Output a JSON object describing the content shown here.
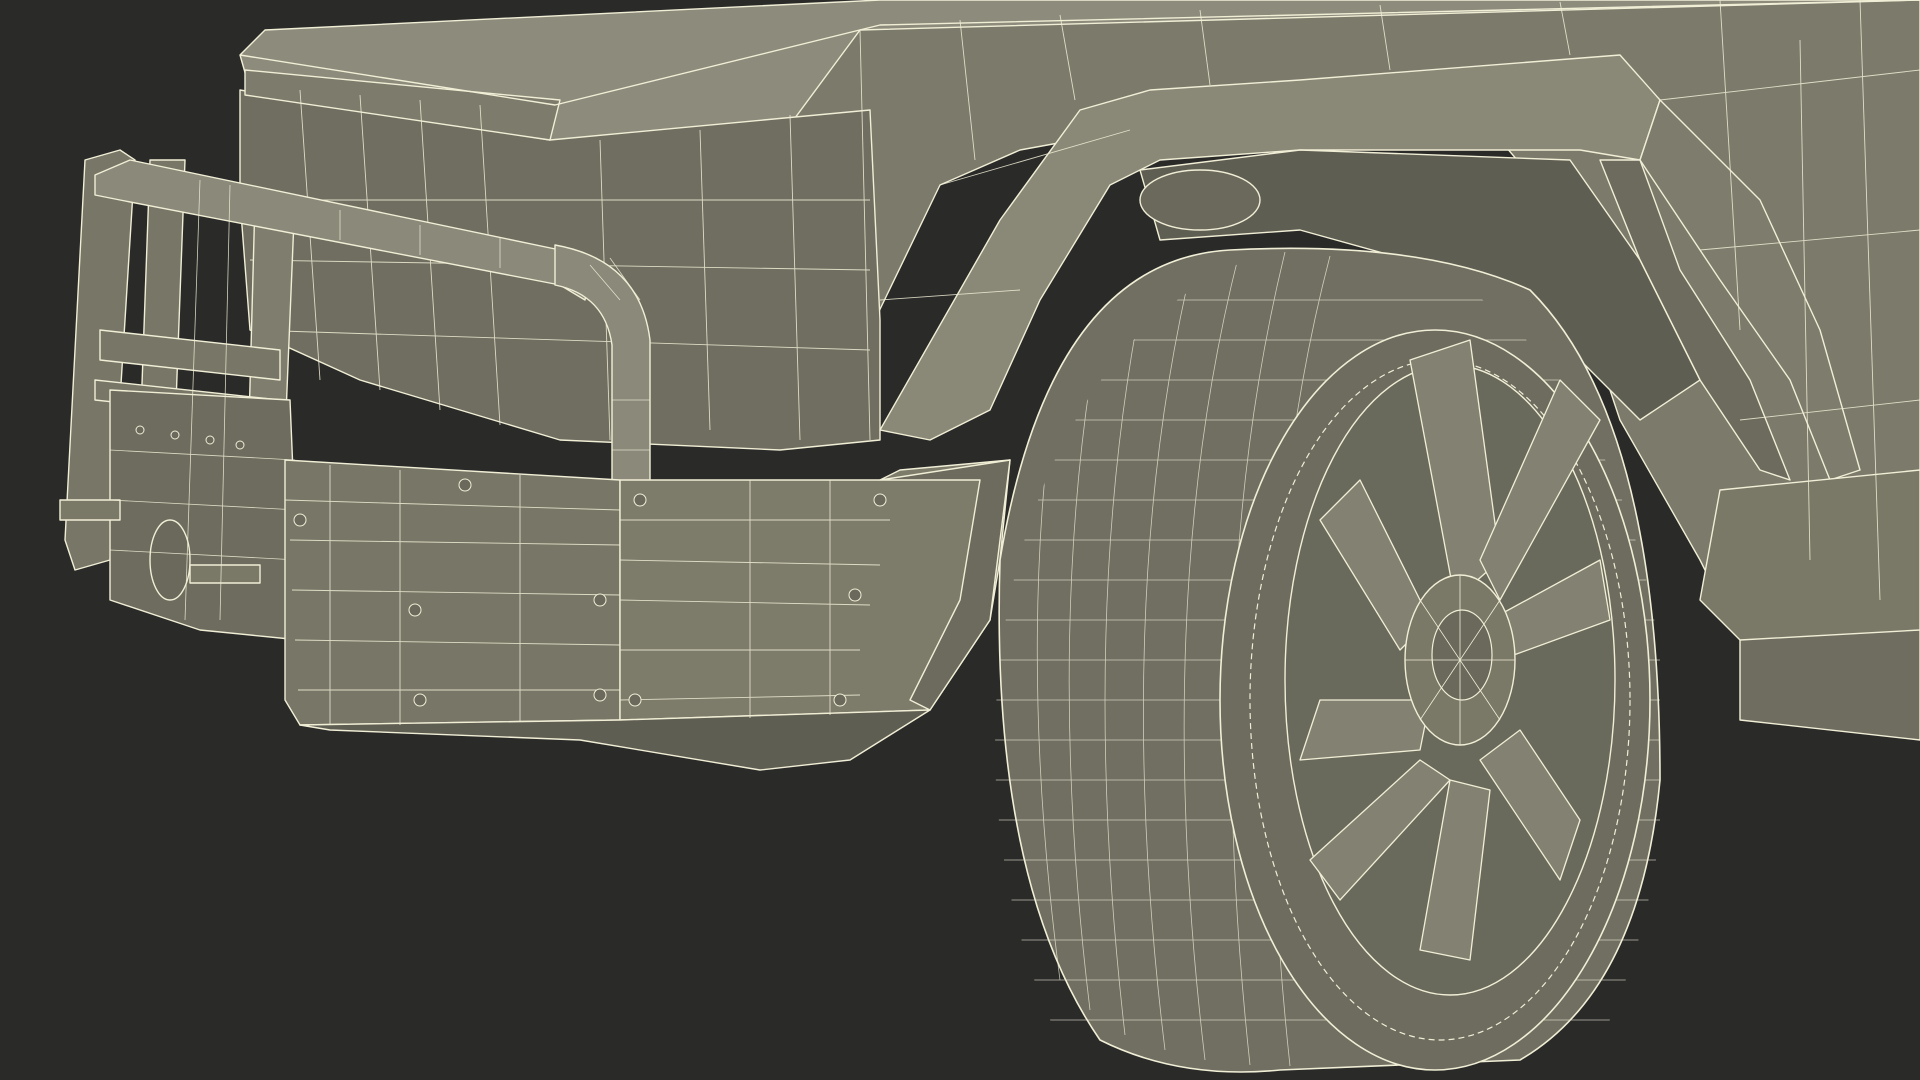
{
  "scene": {
    "subject": "wireframe-render-truck-front-wheel",
    "colors": {
      "background": "#2a2a29",
      "body_fill": "#7b7a6b",
      "body_fill_dark": "#5f5e52",
      "body_fill_light": "#8d8c7c",
      "wire": "#f1eed6",
      "tire_fill": "#706f62",
      "rim_fill": "#6a6a5c"
    }
  }
}
